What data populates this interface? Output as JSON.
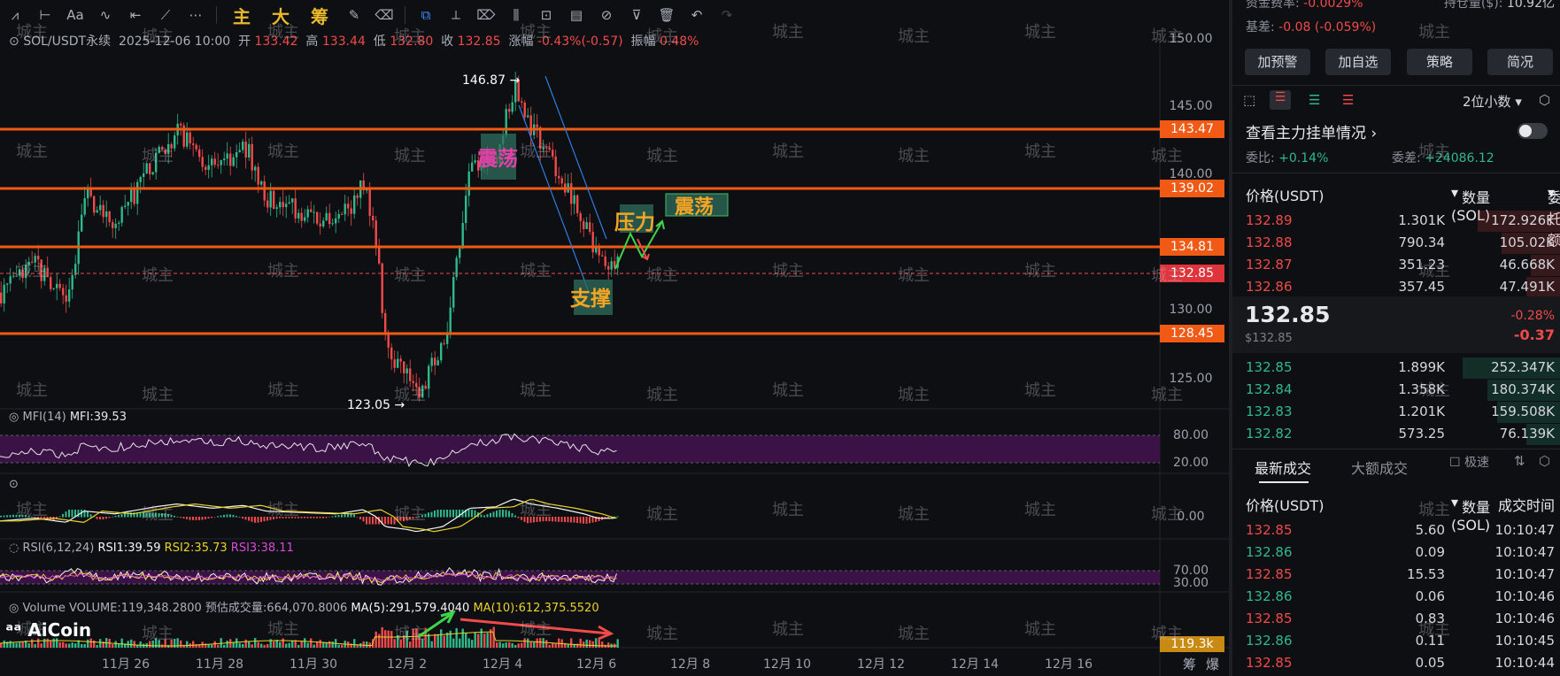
{
  "toolbar": {
    "big_buttons": [
      "主",
      "大",
      "筹"
    ]
  },
  "ticker": {
    "symbol": "SOL/USDT永续",
    "datetime": "2025-12-06 10:00",
    "open_label": "开",
    "open": "133.42",
    "high_label": "高",
    "high": "133.44",
    "low_label": "低",
    "low": "132.80",
    "close_label": "收",
    "close": "132.85",
    "change_label": "涨幅",
    "change": "-0.43%(-0.57)",
    "amp_label": "振幅",
    "amp": "0.48%"
  },
  "price_axis": [
    "150.00",
    "145.00",
    "140.00",
    "130.00",
    "125.00"
  ],
  "levels": [
    "143.47",
    "139.02",
    "134.81",
    "128.45"
  ],
  "current_price_tag": "132.85",
  "annotations": {
    "high_marker": "146.87",
    "low_marker": "123.05",
    "note_oscillate_1": "震荡",
    "note_pressure": "压力",
    "note_oscillate_2": "震荡",
    "note_support": "支撑"
  },
  "mfi": {
    "label": "MFI(14)",
    "value": "MFI:39.53",
    "axis_high": "80.00",
    "axis_low": "20.00"
  },
  "macd": {
    "axis_zero": "0.00"
  },
  "rsi": {
    "label": "RSI(6,12,24)",
    "rsi1": "RSI1:39.59",
    "rsi2": "RSI2:35.73",
    "rsi3": "RSI3:38.11",
    "axis_high": "70.00",
    "axis_low": "30.00"
  },
  "volume": {
    "label": "Volume",
    "value": "VOLUME:119,348.2800",
    "est": "预估成交量:664,070.8006",
    "ma5": "MA(5):291,579.4040",
    "ma10": "MA(10):612,375.5520",
    "tag": "119.3k"
  },
  "x_axis": [
    "11月 26",
    "11月 28",
    "11月 30",
    "12月 2",
    "12月 4",
    "12月 6",
    "12月 8",
    "12月 10",
    "12月 12",
    "12月 14",
    "12月 16"
  ],
  "bottom_right": [
    "筹",
    "爆"
  ],
  "logo": "AiCoin",
  "watermark_text": "城主",
  "panel": {
    "top_left_label": "资金费率:",
    "top_left_value": "-0.0029%",
    "top_right_label": "持仓量($):",
    "top_right_value": "10.92亿",
    "basis_label": "基差:",
    "basis_value": "-0.08 (-0.059%)",
    "buttons": [
      "加预警",
      "加自选",
      "策略",
      "简况"
    ],
    "decimals": "2位小数",
    "main_orders_link": "查看主力挂单情况",
    "ratio_label": "委比:",
    "ratio_value": "+0.14%",
    "diff_label": "委差:",
    "diff_value": "+24086.12",
    "ob_headers": [
      "价格(USDT)",
      "数量 (SOL)",
      "委托额"
    ],
    "asks": [
      {
        "price": "132.89",
        "qty": "1.301K",
        "amt": "172.926K"
      },
      {
        "price": "132.88",
        "qty": "790.34",
        "amt": "105.02K"
      },
      {
        "price": "132.87",
        "qty": "351.23",
        "amt": "46.668K"
      },
      {
        "price": "132.86",
        "qty": "357.45",
        "amt": "47.491K"
      }
    ],
    "last_price": "132.85",
    "last_price_usd": "$132.85",
    "last_change_pct": "-0.28%",
    "last_change": "-0.37",
    "bids": [
      {
        "price": "132.85",
        "qty": "1.899K",
        "amt": "252.347K"
      },
      {
        "price": "132.84",
        "qty": "1.358K",
        "amt": "180.374K"
      },
      {
        "price": "132.83",
        "qty": "1.201K",
        "amt": "159.508K"
      },
      {
        "price": "132.82",
        "qty": "573.25",
        "amt": "76.139K"
      }
    ],
    "trade_tabs": [
      "最新成交",
      "大额成交"
    ],
    "fast_label": "极速",
    "trade_headers": [
      "价格(USDT)",
      "数量(SOL)",
      "成交时间"
    ],
    "trades": [
      {
        "price": "132.85",
        "qty": "5.60",
        "time": "10:10:47",
        "side": "sell"
      },
      {
        "price": "132.86",
        "qty": "0.09",
        "time": "10:10:47",
        "side": "buy"
      },
      {
        "price": "132.85",
        "qty": "15.53",
        "time": "10:10:47",
        "side": "sell"
      },
      {
        "price": "132.86",
        "qty": "0.06",
        "time": "10:10:46",
        "side": "buy"
      },
      {
        "price": "132.85",
        "qty": "0.83",
        "time": "10:10:46",
        "side": "sell"
      },
      {
        "price": "132.86",
        "qty": "0.11",
        "time": "10:10:45",
        "side": "buy"
      },
      {
        "price": "132.85",
        "qty": "0.05",
        "time": "10:10:44",
        "side": "sell"
      }
    ]
  },
  "colors": {
    "up": "#2fb98a",
    "down": "#f04a4a",
    "level": "#f05a14",
    "accent": "#e8b92b"
  }
}
